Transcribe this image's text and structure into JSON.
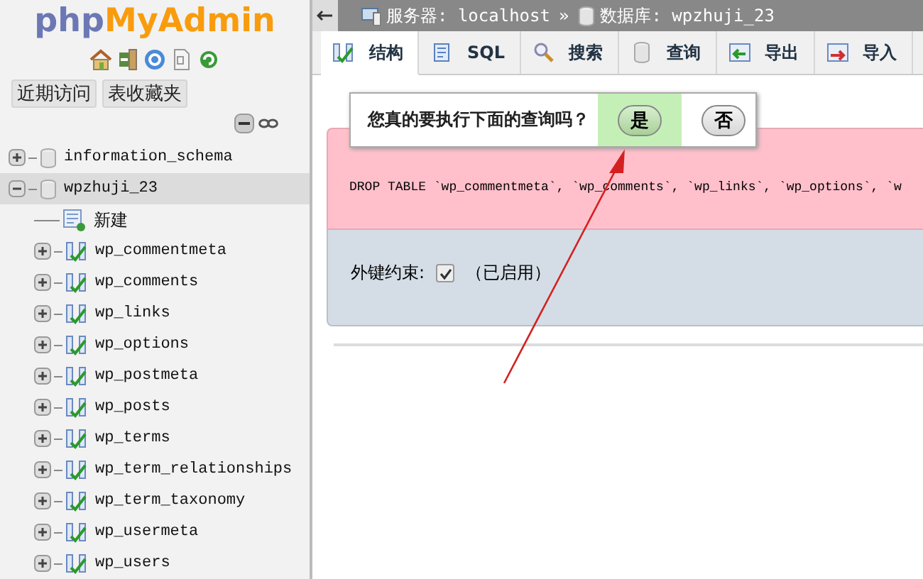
{
  "sidebar": {
    "logo": {
      "part_1": "php",
      "part_2": "MyAdmin"
    },
    "quick_tabs": [
      {
        "label": "近期访问"
      },
      {
        "label": "表收藏夹"
      }
    ],
    "tree": [
      {
        "kind": "database",
        "label": "information_schema",
        "expanded": false,
        "selected": false
      },
      {
        "kind": "database",
        "label": "wpzhuji_23",
        "expanded": true,
        "selected": true,
        "children": [
          {
            "kind": "new",
            "label": "新建"
          },
          {
            "kind": "table",
            "label": "wp_commentmeta",
            "expanded": false
          },
          {
            "kind": "table",
            "label": "wp_comments",
            "expanded": false
          },
          {
            "kind": "table",
            "label": "wp_links",
            "expanded": false
          },
          {
            "kind": "table",
            "label": "wp_options",
            "expanded": false
          },
          {
            "kind": "table",
            "label": "wp_postmeta",
            "expanded": false
          },
          {
            "kind": "table",
            "label": "wp_posts",
            "expanded": false
          },
          {
            "kind": "table",
            "label": "wp_terms",
            "expanded": false
          },
          {
            "kind": "table",
            "label": "wp_term_relationships",
            "expanded": false
          },
          {
            "kind": "table",
            "label": "wp_term_taxonomy",
            "expanded": false
          },
          {
            "kind": "table",
            "label": "wp_usermeta",
            "expanded": false
          },
          {
            "kind": "table",
            "label": "wp_users",
            "expanded": false
          }
        ]
      }
    ]
  },
  "breadcrumb": [
    {
      "kind": "server",
      "label": "服务器: localhost"
    },
    {
      "kind": "database",
      "label": "数据库: wpzhuji_23"
    }
  ],
  "breadcrumb_separator": "»",
  "tabs": [
    {
      "kind": "structure",
      "label": "结构",
      "selected": true
    },
    {
      "kind": "sql",
      "label": "SQL",
      "selected": false
    },
    {
      "kind": "search",
      "label": "搜索",
      "selected": false
    },
    {
      "kind": "query",
      "label": "查询",
      "selected": false
    },
    {
      "kind": "export",
      "label": "导出",
      "selected": false
    },
    {
      "kind": "import",
      "label": "导入",
      "selected": false
    }
  ],
  "confirm_dialog": {
    "question": "您真的要执行下面的查询吗？",
    "buttons": [
      {
        "label": "是",
        "selected": true
      },
      {
        "label": "否",
        "selected": false
      }
    ]
  },
  "query": "DROP TABLE `wp_commentmeta`, `wp_comments`, `wp_links`, `wp_options`, `w",
  "foreign_key": {
    "label": "外键约束:",
    "checked": true,
    "status": "（已启用）"
  }
}
